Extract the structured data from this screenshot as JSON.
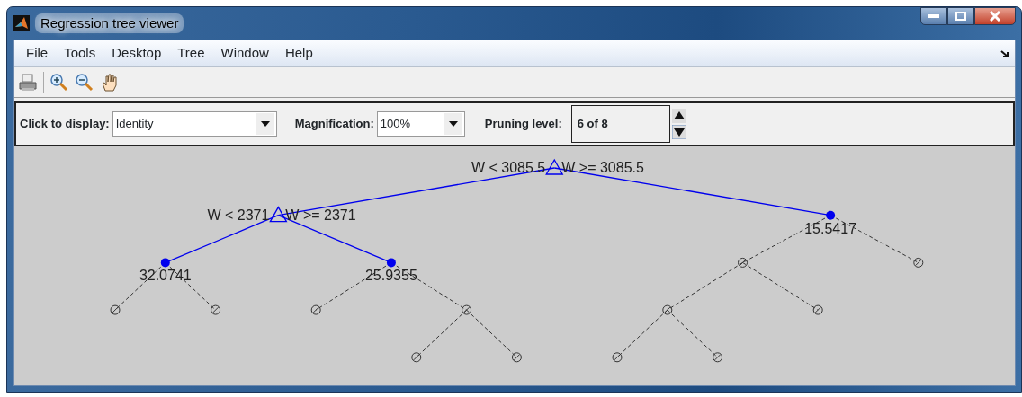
{
  "window": {
    "title": "Regression tree viewer"
  },
  "menu": [
    "File",
    "Tools",
    "Desktop",
    "Tree",
    "Window",
    "Help"
  ],
  "controls": {
    "display_label": "Click to display:",
    "display_value": "Identity",
    "magnification_label": "Magnification:",
    "magnification_value": "100%",
    "pruning_label": "Pruning level:",
    "pruning_value": "6 of 8"
  },
  "tree": {
    "kind": "branch",
    "pruned": false,
    "left_label": "W < 3085.5",
    "right_label": "W >= 3085.5",
    "children": [
      {
        "kind": "branch",
        "pruned": false,
        "left_label": "W < 2371",
        "right_label": "W >= 2371",
        "children": [
          {
            "kind": "leaf",
            "pruned": false,
            "value": "32.0741",
            "children": [
              {
                "pruned": true
              },
              {
                "pruned": true
              }
            ]
          },
          {
            "kind": "leaf",
            "pruned": false,
            "value": "25.9355",
            "children": [
              {
                "pruned": true
              },
              {
                "pruned": true,
                "children": [
                  {
                    "pruned": true
                  },
                  {
                    "pruned": true
                  }
                ]
              }
            ]
          }
        ]
      },
      {
        "kind": "leaf",
        "pruned": false,
        "value": "15.5417",
        "children": [
          {
            "pruned": true,
            "children": [
              {
                "pruned": true,
                "children": [
                  {
                    "pruned": true
                  },
                  {
                    "pruned": true
                  }
                ]
              },
              {
                "pruned": true
              }
            ]
          },
          {
            "pruned": true
          }
        ]
      }
    ]
  }
}
